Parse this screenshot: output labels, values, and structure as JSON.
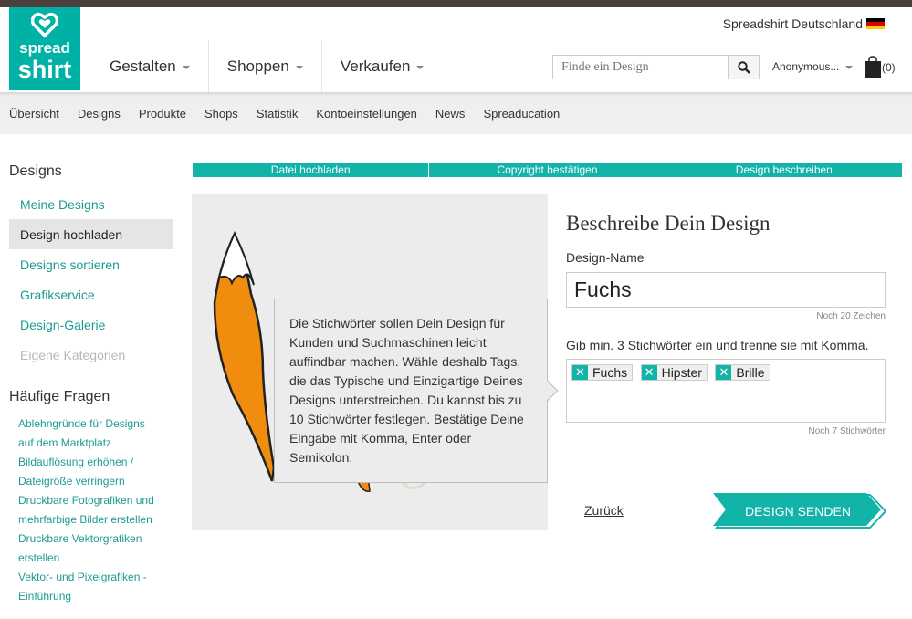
{
  "header": {
    "logo_line1": "spread",
    "logo_line2": "shirt",
    "country": "Spreadshirt Deutschland",
    "main_nav": [
      {
        "label": "Gestalten"
      },
      {
        "label": "Shoppen"
      },
      {
        "label": "Verkaufen"
      }
    ],
    "search_placeholder": "Finde ein Design",
    "account": "Anonymous...",
    "cart_count": "(0)"
  },
  "subnav": [
    "Übersicht",
    "Designs",
    "Produkte",
    "Shops",
    "Statistik",
    "Kontoeinstellungen",
    "News",
    "Spreaducation"
  ],
  "sidebar": {
    "title": "Designs",
    "items": [
      "Meine Designs",
      "Design hochladen",
      "Designs sortieren",
      "Grafikservice",
      "Design-Galerie",
      "Eigene Kategorien"
    ],
    "faq_title": "Häufige Fragen",
    "faq_lines": [
      "Ablehngründe für Designs",
      "auf dem Marktplatz",
      "Bildauflösung erhöhen /",
      "Dateigröße verringern",
      "Druckbare Fotografiken und",
      "mehrfarbige Bilder erstellen",
      "Druckbare Vektorgrafiken",
      "erstellen",
      "Vektor- und Pixelgrafiken -",
      "Einführung"
    ]
  },
  "steps": [
    "Datei hochladen",
    "Copyright bestätigen",
    "Design beschreiben"
  ],
  "tooltip": "Die Stichwörter sollen Dein Design für Kunden und Suchmaschinen leicht auffindbar machen. Wähle deshalb Tags, die das Typische und Einzigartige Deines Designs unterstreichen. Du kannst bis zu 10 Stichwörter festlegen. Bestätige Deine Eingabe mit Komma, Enter oder Semikolon.",
  "form": {
    "title": "Beschreibe Dein Design",
    "name_label": "Design-Name",
    "name_value": "Fuchs",
    "name_hint": "Noch 20 Zeichen",
    "tags_label": "Gib min. 3 Stichwörter ein und trenne sie mit Komma.",
    "tags": [
      "Fuchs",
      "Hipster",
      "Brille"
    ],
    "tags_hint": "Noch 7 Stichwörter",
    "back_label": "Zurück",
    "submit_label": "DESIGN SENDEN"
  },
  "colors": {
    "brand": "#00b2a5",
    "step_bar": "#12b3a8",
    "link": "#1b9b92",
    "fox": "#f08c0e"
  }
}
